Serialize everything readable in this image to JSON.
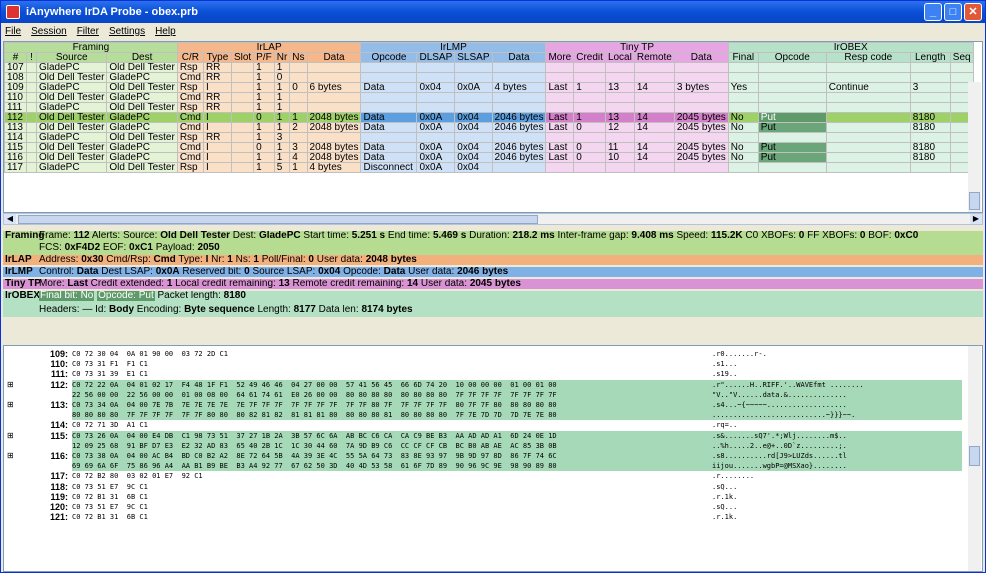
{
  "title": "iAnywhere IrDA Probe - obex.prb",
  "menu": [
    "File",
    "Session",
    "Filter",
    "Settings",
    "Help"
  ],
  "groups": [
    {
      "label": "Framing",
      "cls": "gF",
      "span": 3
    },
    {
      "label": "IrLAP",
      "cls": "gL",
      "span": 7
    },
    {
      "label": "IrLMP",
      "cls": "gM",
      "span": 4
    },
    {
      "label": "Tiny TP",
      "cls": "gT",
      "span": 5
    },
    {
      "label": "IrOBEX",
      "cls": "gO",
      "span": 5
    }
  ],
  "columns": [
    "#",
    "!",
    "Source",
    "Dest",
    "C/R",
    "Type",
    "Slot",
    "P/F",
    "Nr",
    "Ns",
    "Data",
    "Opcode",
    "DLSAP",
    "SLSAP",
    "Data",
    "More",
    "Credit",
    "Local",
    "Remote",
    "Data",
    "Final",
    "Opcode",
    "Resp code",
    "Length",
    "Seq"
  ],
  "rows": [
    [
      "107",
      "",
      "GladePC",
      "Old Dell Tester",
      "Rsp",
      "RR",
      "",
      "1",
      "1",
      "",
      "",
      "",
      "",
      "",
      "",
      "",
      "",
      "",
      "",
      "",
      "",
      "",
      "",
      "",
      ""
    ],
    [
      "108",
      "",
      "Old Dell Tester",
      "GladePC",
      "Cmd",
      "RR",
      "",
      "1",
      "0",
      "",
      "",
      "",
      "",
      "",
      "",
      "",
      "",
      "",
      "",
      "",
      "",
      "",
      "",
      "",
      ""
    ],
    [
      "109",
      "",
      "GladePC",
      "Old Dell Tester",
      "Rsp",
      "I",
      "",
      "1",
      "1",
      "0",
      "6 bytes",
      "Data",
      "0x04",
      "0x0A",
      "4 bytes",
      "Last",
      "1",
      "13",
      "14",
      "3 bytes",
      "Yes",
      "",
      "Continue",
      "3",
      ""
    ],
    [
      "110",
      "",
      "Old Dell Tester",
      "GladePC",
      "Cmd",
      "RR",
      "",
      "1",
      "1",
      "",
      "",
      "",
      "",
      "",
      "",
      "",
      "",
      "",
      "",
      "",
      "",
      "",
      "",
      "",
      ""
    ],
    [
      "111",
      "",
      "GladePC",
      "Old Dell Tester",
      "Rsp",
      "RR",
      "",
      "1",
      "1",
      "",
      "",
      "",
      "",
      "",
      "",
      "",
      "",
      "",
      "",
      "",
      "",
      "",
      "",
      "",
      ""
    ],
    [
      "112",
      "",
      "Old Dell Tester",
      "GladePC",
      "Cmd",
      "I",
      "",
      "0",
      "1",
      "1",
      "2048 bytes",
      "Data",
      "0x0A",
      "0x04",
      "2046 bytes",
      "Last",
      "1",
      "13",
      "14",
      "2045 bytes",
      "No",
      "Put",
      "",
      "8180",
      ""
    ],
    [
      "113",
      "",
      "Old Dell Tester",
      "GladePC",
      "Cmd",
      "I",
      "",
      "1",
      "1",
      "2",
      "2048 bytes",
      "Data",
      "0x0A",
      "0x04",
      "2046 bytes",
      "Last",
      "0",
      "12",
      "14",
      "2045 bytes",
      "No",
      "Put",
      "",
      "8180",
      ""
    ],
    [
      "114",
      "",
      "GladePC",
      "Old Dell Tester",
      "Rsp",
      "RR",
      "",
      "1",
      "3",
      "",
      "",
      "",
      "",
      "",
      "",
      "",
      "",
      "",
      "",
      "",
      "",
      "",
      "",
      "",
      ""
    ],
    [
      "115",
      "",
      "Old Dell Tester",
      "GladePC",
      "Cmd",
      "I",
      "",
      "0",
      "1",
      "3",
      "2048 bytes",
      "Data",
      "0x0A",
      "0x04",
      "2046 bytes",
      "Last",
      "0",
      "11",
      "14",
      "2045 bytes",
      "No",
      "Put",
      "",
      "8180",
      ""
    ],
    [
      "116",
      "",
      "Old Dell Tester",
      "GladePC",
      "Cmd",
      "I",
      "",
      "1",
      "1",
      "4",
      "2048 bytes",
      "Data",
      "0x0A",
      "0x04",
      "2046 bytes",
      "Last",
      "0",
      "10",
      "14",
      "2045 bytes",
      "No",
      "Put",
      "",
      "8180",
      ""
    ],
    [
      "117",
      "",
      "GladePC",
      "Old Dell Tester",
      "Rsp",
      "I",
      "",
      "1",
      "5",
      "1",
      "4 bytes",
      "Disconnect",
      "0x0A",
      "0x04",
      "",
      "",
      "",
      "",
      "",
      "",
      "",
      "",
      "",
      "",
      ""
    ]
  ],
  "detail": {
    "framing_label": "Framing",
    "framing_line1": [
      [
        "Frame: ",
        "112"
      ],
      [
        "  Alerts:  Source: ",
        "Old Dell Tester"
      ],
      [
        "  Dest: ",
        "GladePC"
      ],
      [
        "  Start time: ",
        "5.251 s"
      ],
      [
        "  End time: ",
        "5.469 s"
      ],
      [
        "  Duration: ",
        "218.2 ms"
      ],
      [
        "  Inter-frame gap: ",
        "9.408 ms"
      ],
      [
        "  Speed: ",
        "115.2K"
      ],
      [
        "  C0 XBOFs: ",
        "0"
      ],
      [
        "  FF XBOFs: ",
        "0"
      ],
      [
        "  BOF: ",
        "0xC0"
      ]
    ],
    "framing_line2": [
      [
        "FCS: ",
        "0xF4D2"
      ],
      [
        "  EOF: ",
        "0xC1"
      ],
      [
        "  Payload: ",
        "2050"
      ]
    ],
    "irlap_label": "IrLAP",
    "irlap": [
      [
        "Address: ",
        "0x30"
      ],
      [
        "  Cmd/Rsp: ",
        "Cmd"
      ],
      [
        "  Type: ",
        "I"
      ],
      [
        "  Nr: ",
        "1"
      ],
      [
        "  Ns: ",
        "1"
      ],
      [
        "  Poll/Final: ",
        "0"
      ],
      [
        "  User data: ",
        "2048 bytes"
      ]
    ],
    "irlmp_label": "IrLMP",
    "irlmp": [
      [
        "Control: ",
        "Data"
      ],
      [
        "  Dest LSAP: ",
        "0x0A"
      ],
      [
        "  Reserved bit: ",
        "0"
      ],
      [
        "  Source LSAP: ",
        "0x04"
      ],
      [
        "  Opcode: ",
        "Data"
      ],
      [
        "  User data: ",
        "2046 bytes"
      ]
    ],
    "ttp_label": "Tiny TP",
    "ttp": [
      [
        "More: ",
        "Last"
      ],
      [
        "  Credit extended: ",
        "1"
      ],
      [
        "  Local credit remaining: ",
        "13"
      ],
      [
        "  Remote credit remaining: ",
        "14"
      ],
      [
        "  User data: ",
        "2045 bytes"
      ]
    ],
    "obex_label": "IrOBEX",
    "obex_final": "Final bit: No",
    "obex_opcode": "Opcode: Put",
    "obex_rest": [
      [
        "  Packet length: ",
        "8180"
      ]
    ],
    "obex_line2": [
      [
        "Headers: — Id: ",
        "Body"
      ],
      [
        "  Encoding: ",
        "Byte sequence"
      ],
      [
        "  Length: ",
        "8177"
      ],
      [
        "  Data len: ",
        "8174 bytes"
      ]
    ]
  },
  "hex": [
    {
      "n": "109:",
      "x": "",
      "h": "C0 72 30 04  0A 01 90 00  03 72 2D C1",
      "a": ".r0.......r-.",
      "g": false
    },
    {
      "n": "110:",
      "x": "",
      "h": "C0 73 31 F1  F1 C1",
      "a": ".s1...",
      "g": false
    },
    {
      "n": "111:",
      "x": "",
      "h": "C0 73 31 39  E1 C1",
      "a": ".s19..",
      "g": false
    },
    {
      "n": "112:",
      "x": "⊞",
      "h": "C0 72 22 0A  04 01 02 17  F4 48 1F F1  52 49 46 46  04 27 00 00  57 41 56 45  66 6D 74 20  10 00 00 00  01 00 01 00",
      "a": ".r\"......H..RIFF.'..WAVEfmt ........",
      "g": true
    },
    {
      "n": "",
      "x": "",
      "h": "22 56 00 00  22 56 00 00  01 00 08 00  64 61 74 61  E0 26 00 00  80 80 80 80  80 80 80 80  7F 7F 7F 7F  7F 7F 7F 7F",
      "a": "\"V..\"V......data.&..............",
      "g": true
    },
    {
      "n": "113:",
      "x": "⊞",
      "h": "C0 73 34 0A  04 00 7E 7B  7E 7E 7E 7E  7E 7F 7F 7F  7F 7F 7F 7F  7F 7F 80 7F  7F 7F 7F 7F  80 7F 7F 80  80 80 80 80",
      "a": ".s4...~{~~~~~...................",
      "g": true
    },
    {
      "n": "",
      "x": "",
      "h": "80 80 80 80  7F 7F 7F 7F  7F 7F 80 80  80 82 81 82  81 81 81 80  80 80 80 81  80 80 80 80  7F 7E 7D 7D  7D 7E 7E 80",
      "a": "...........................~}}}~~.",
      "g": true
    },
    {
      "n": "114:",
      "x": "",
      "h": "C0 72 71 3D  A1 C1",
      "a": ".rq=..",
      "g": false
    },
    {
      "n": "115:",
      "x": "⊞",
      "h": "C0 73 26 0A  04 00 E4 DB  C1 98 73 51  37 27 1B 2A  3B 57 6C 6A  AB BC C6 CA  CA C9 BE B3  AA AD AD A1  6D 24 0E 1D",
      "a": ".s&.......sQ7'.*;Wlj........m$..",
      "g": true
    },
    {
      "n": "",
      "x": "",
      "h": "12 09 25 68  91 BF D7 E3  E2 32 AD 83  65 40 2B 1C  1C 30 44 60  7A 9D B9 C6  CC CF CF CB  BC B0 AB AE  AC 85 3B 0B",
      "a": "..%h.....2..e@+..0D`z.........;.",
      "g": true
    },
    {
      "n": "116:",
      "x": "⊞",
      "h": "C0 73 38 0A  04 00 AC B4  BD C0 B2 A2  8E 72 64 5B  4A 39 3E 4C  55 5A 64 73  83 8E 93 97  9B 9D 97 8D  86 7F 74 6C",
      "a": ".s8..........rd[J9>LUZds......tl",
      "g": true
    },
    {
      "n": "",
      "x": "",
      "h": "69 69 6A 6F  75 86 96 A4  AA B1 B9 BE  B3 A4 92 77  67 62 50 3D  40 4D 53 58  61 6F 7D 89  90 96 9C 9E  98 90 89 80",
      "a": "iijou.......wgbP=@MSXao}........",
      "g": true
    },
    {
      "n": "117:",
      "x": "",
      "h": "C0 72 B2 80  03 02 01 E7  92 C1",
      "a": ".r........",
      "g": false
    },
    {
      "n": "118:",
      "x": "",
      "h": "C0 73 51 E7  9C C1",
      "a": ".sQ...",
      "g": false
    },
    {
      "n": "119:",
      "x": "",
      "h": "C0 72 B1 31  6B C1",
      "a": ".r.1k.",
      "g": false
    },
    {
      "n": "120:",
      "x": "",
      "h": "C0 73 51 E7  9C C1",
      "a": ".sQ...",
      "g": false
    },
    {
      "n": "121:",
      "x": "",
      "h": "C0 72 B1 31  6B C1",
      "a": ".r.1k.",
      "g": false
    }
  ]
}
